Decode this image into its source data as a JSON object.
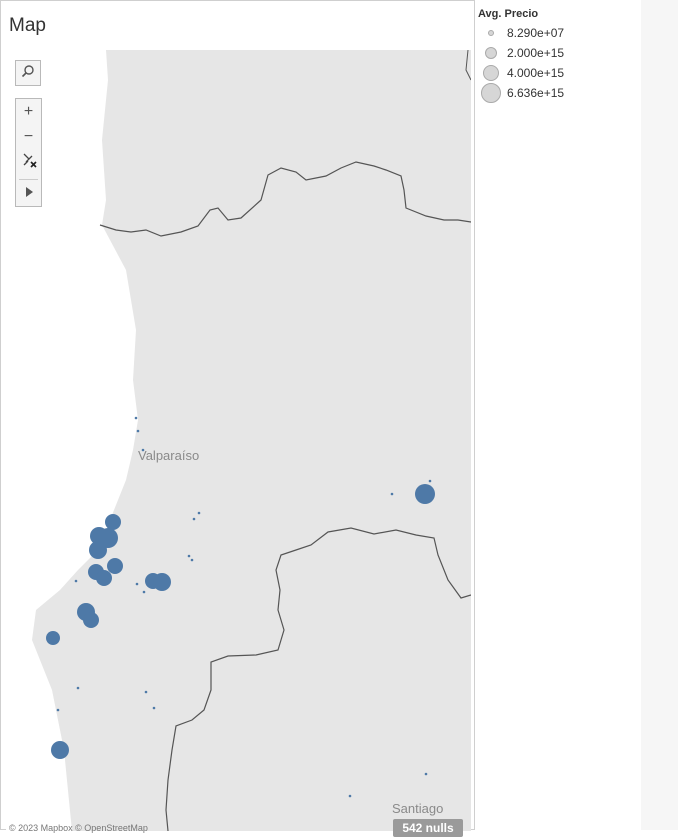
{
  "sheet": {
    "title": "Map"
  },
  "map": {
    "places": [
      "Valparaíso",
      "Santiago"
    ],
    "nulls_label": "542 nulls",
    "attribution": "© 2023 Mapbox © OpenStreetMap",
    "mark_color": "#4e79a7",
    "toolbar": {
      "search_icon": "search-icon",
      "zoom_in": "+",
      "zoom_out": "−",
      "pin_icon": "unpin-icon",
      "expand_icon": "play-arrow-icon"
    }
  },
  "legend": {
    "title": "Avg. Precio",
    "items": [
      "8.290e+07",
      "2.000e+15",
      "4.000e+15",
      "6.636e+15"
    ]
  }
}
